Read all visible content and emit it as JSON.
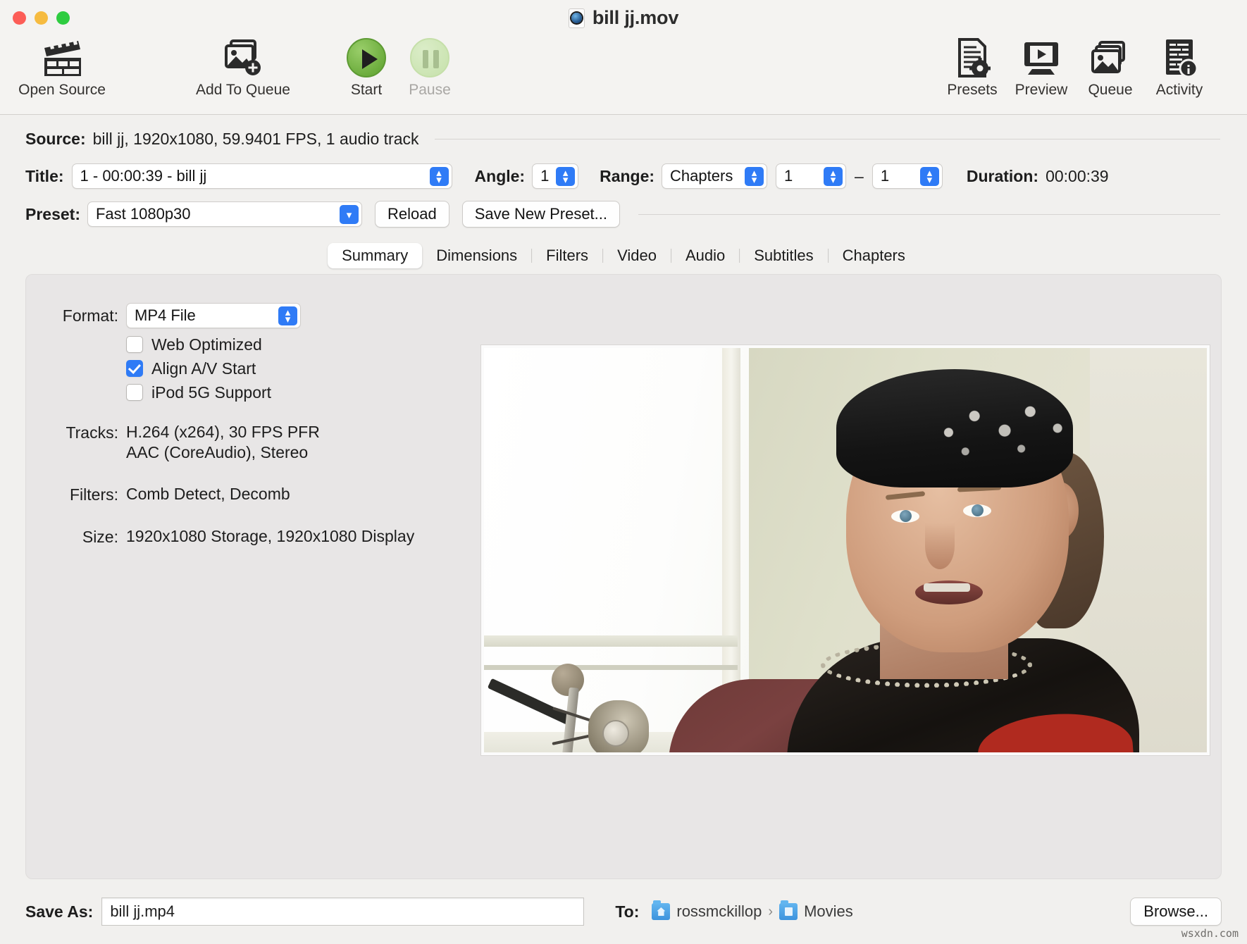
{
  "window": {
    "title": "bill jj.mov",
    "title_icon": "quicktime-document-icon"
  },
  "toolbar": {
    "items": [
      {
        "label": "Open Source",
        "icon": "clapperboard-icon"
      },
      {
        "label": "Add To Queue",
        "icon": "add-image-icon"
      },
      {
        "label": "Start",
        "icon": "play-circle-icon"
      },
      {
        "label": "Pause",
        "icon": "pause-circle-icon",
        "disabled": true
      },
      {
        "label": "Presets",
        "icon": "document-gear-icon"
      },
      {
        "label": "Preview",
        "icon": "monitor-play-icon"
      },
      {
        "label": "Queue",
        "icon": "stacked-images-icon"
      },
      {
        "label": "Activity",
        "icon": "document-info-icon"
      }
    ]
  },
  "source": {
    "label": "Source:",
    "value": "bill jj, 1920x1080, 59.9401 FPS, 1 audio track"
  },
  "title_row": {
    "label": "Title:",
    "value": "1 - 00:00:39 - bill jj",
    "angle_label": "Angle:",
    "angle_value": "1",
    "range_label": "Range:",
    "range_kind": "Chapters",
    "range_start": "1",
    "range_dash": "–",
    "range_end": "1",
    "duration_label": "Duration:",
    "duration_value": "00:00:39"
  },
  "preset_row": {
    "label": "Preset:",
    "value": "Fast 1080p30",
    "reload_label": "Reload",
    "save_new_label": "Save New Preset..."
  },
  "tabs": [
    {
      "label": "Summary",
      "active": true
    },
    {
      "label": "Dimensions",
      "active": false
    },
    {
      "label": "Filters",
      "active": false
    },
    {
      "label": "Video",
      "active": false
    },
    {
      "label": "Audio",
      "active": false
    },
    {
      "label": "Subtitles",
      "active": false
    },
    {
      "label": "Chapters",
      "active": false
    }
  ],
  "summary": {
    "format_label": "Format:",
    "format_value": "MP4 File",
    "checkboxes": [
      {
        "label": "Web Optimized",
        "checked": false
      },
      {
        "label": "Align A/V Start",
        "checked": true
      },
      {
        "label": "iPod 5G Support",
        "checked": false
      }
    ],
    "tracks_label": "Tracks:",
    "tracks_line1": "H.264 (x264), 30 FPS PFR",
    "tracks_line2": "AAC (CoreAudio), Stereo",
    "filters_label": "Filters:",
    "filters_value": "Comb Detect, Decomb",
    "size_label": "Size:",
    "size_value": "1920x1080 Storage, 1920x1080 Display"
  },
  "preview": {
    "description": "Video still frame: man wearing a black-and-white paisley bandana headband and dark patterned sweater, speaking, with a bright blown-out window on the left and a vintage microphone on a boom arm in the lower left, pale green wall behind"
  },
  "bottom": {
    "save_as_label": "Save As:",
    "save_as_value": "bill jj.mp4",
    "to_label": "To:",
    "crumb_user": "rossmckillop",
    "crumb_sep": "›",
    "crumb_folder": "Movies",
    "browse_label": "Browse..."
  },
  "watermark": "wsxdn.com",
  "colors": {
    "accent": "#2f7bf6",
    "window_bg": "#f1f0ee",
    "toolbar_bg": "#f4f3f1",
    "panel_bg": "#e8e6e6",
    "start_green": "#6aab3b"
  }
}
